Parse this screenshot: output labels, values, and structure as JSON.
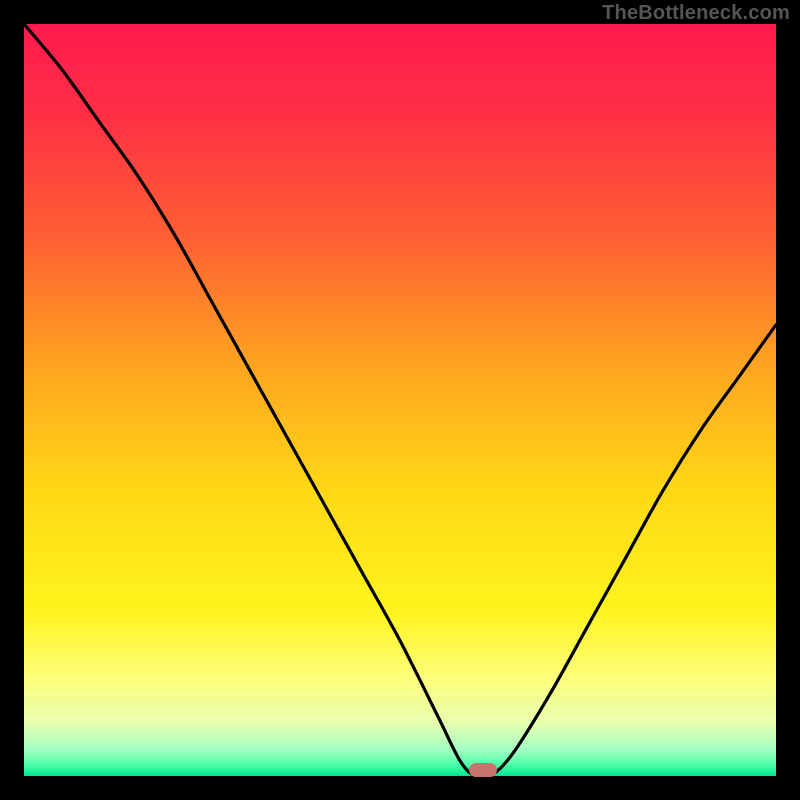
{
  "watermark": "TheBottleneck.com",
  "colors": {
    "gradient_stops": [
      {
        "offset": 0.0,
        "color": "#ff1a4d"
      },
      {
        "offset": 0.12,
        "color": "#ff2f45"
      },
      {
        "offset": 0.28,
        "color": "#ff5e34"
      },
      {
        "offset": 0.45,
        "color": "#ffa321"
      },
      {
        "offset": 0.62,
        "color": "#ffd815"
      },
      {
        "offset": 0.78,
        "color": "#fff41d"
      },
      {
        "offset": 0.87,
        "color": "#fdfe7b"
      },
      {
        "offset": 0.93,
        "color": "#e6ffb0"
      },
      {
        "offset": 0.965,
        "color": "#a3ffc3"
      },
      {
        "offset": 0.985,
        "color": "#4bffa8"
      },
      {
        "offset": 1.0,
        "color": "#00e490"
      }
    ],
    "curve": "#000000",
    "marker": "#c9736f",
    "frame": "#000000"
  },
  "chart_data": {
    "type": "line",
    "title": "",
    "xlabel": "",
    "ylabel": "",
    "xlim": [
      0,
      100
    ],
    "ylim": [
      0,
      100
    ],
    "series": [
      {
        "name": "bottleneck-curve",
        "x": [
          0,
          5,
          10,
          15,
          20,
          25,
          30,
          35,
          40,
          45,
          50,
          55,
          58,
          60,
          62,
          65,
          70,
          75,
          80,
          85,
          90,
          95,
          100
        ],
        "y": [
          100,
          94,
          87,
          80,
          72,
          63,
          54,
          45,
          36,
          27,
          18,
          8,
          2,
          0,
          0,
          3,
          11,
          20,
          29,
          38,
          46,
          53,
          60
        ]
      }
    ],
    "marker": {
      "x": 61,
      "y": 0
    },
    "annotations": [
      {
        "text": "TheBottleneck.com",
        "role": "watermark",
        "position": "top-right"
      }
    ]
  }
}
